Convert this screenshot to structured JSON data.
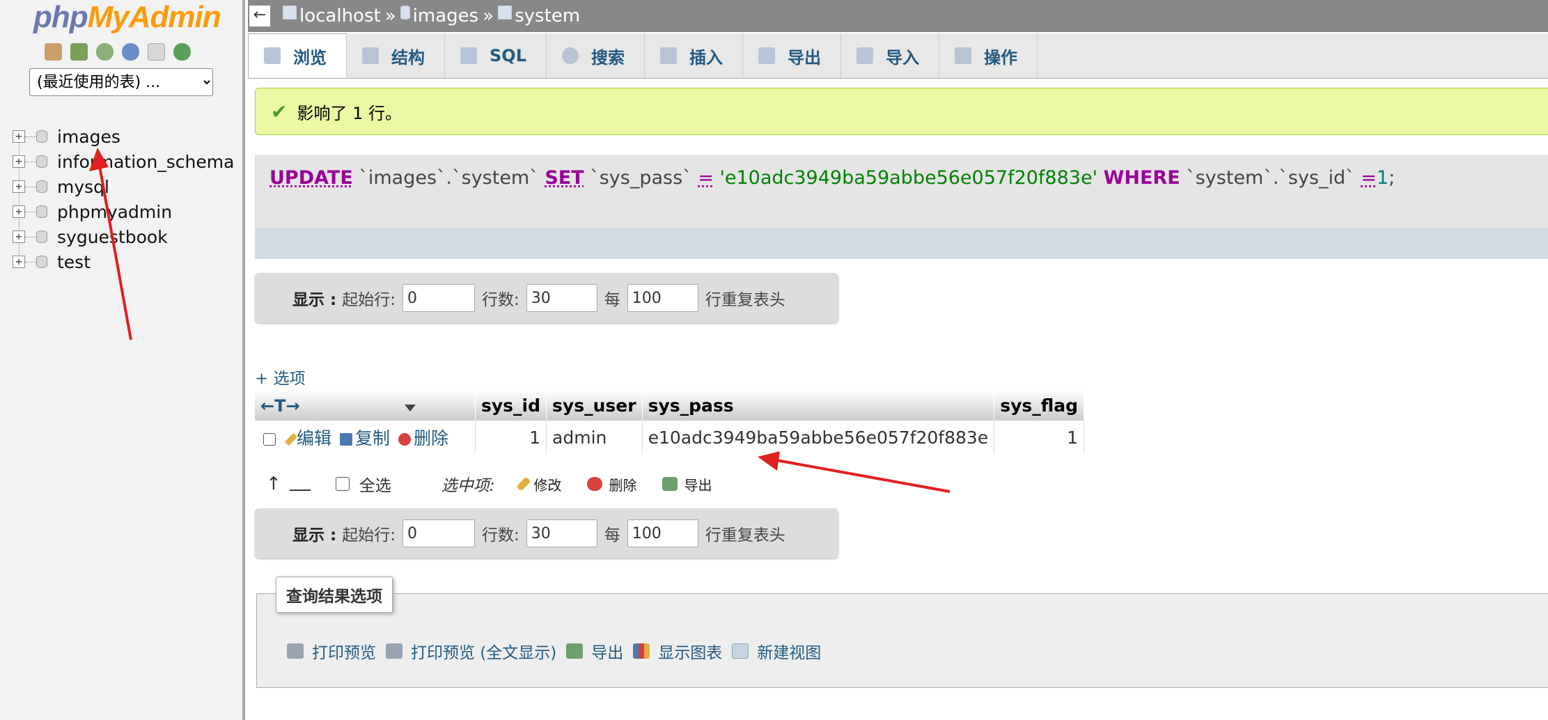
{
  "nav": {
    "logo_php": "php",
    "logo_myadmin": "MyAdmin",
    "recent_tables": "(最近使用的表) ...",
    "icons": [
      "home-icon",
      "exit-icon",
      "query-window-icon",
      "docs-icon",
      "copy-icon",
      "reload-icon"
    ],
    "databases": [
      "images",
      "information_schema",
      "mysql",
      "phpmyadmin",
      "syguestbook",
      "test"
    ],
    "expand_symbol": "+"
  },
  "breadcrumb": {
    "back": "←",
    "server": "localhost",
    "database": "images",
    "table": "system",
    "sep": "»"
  },
  "tabs": [
    "浏览",
    "结构",
    "SQL",
    "搜索",
    "插入",
    "导出",
    "导入",
    "操作"
  ],
  "message": {
    "check": "✔",
    "text": "影响了 1 行。"
  },
  "sql": {
    "kw_update": "UPDATE",
    "table": " `images`.`system` ",
    "kw_set": "SET",
    "col": " `sys_pass` ",
    "eq1": "=",
    "value": " 'e10adc3949ba59abbe56e057f20f883e' ",
    "kw_where": "WHERE",
    "cond": " `system`.`sys_id` ",
    "eq2": "=",
    "num": "1",
    "semi": ";"
  },
  "navbar": {
    "show": "显示 :",
    "start_label": "起始行:",
    "start_value": "0",
    "rows_label": "行数:",
    "rows_value": "30",
    "every": "每",
    "every_value": "100",
    "repeat": "行重复表头"
  },
  "options_link": "+ 选项",
  "table": {
    "arrows": "←T→",
    "columns": [
      "sys_id",
      "sys_user",
      "sys_pass",
      "sys_flag"
    ],
    "actions": {
      "edit": "编辑",
      "copy": "复制",
      "delete": "删除"
    },
    "row": {
      "sys_id": "1",
      "sys_user": "admin",
      "sys_pass": "e10adc3949ba59abbe56e057f20f883e",
      "sys_flag": "1"
    }
  },
  "selection": {
    "arrow": "↑",
    "check_all": "全选",
    "with_selected": "选中项:",
    "modify": "修改",
    "delete": "删除",
    "export": "导出"
  },
  "query_results": {
    "legend": "查询结果选项",
    "links": [
      "打印预览",
      "打印预览 (全文显示)",
      "导出",
      "显示图表",
      "新建视图"
    ]
  }
}
